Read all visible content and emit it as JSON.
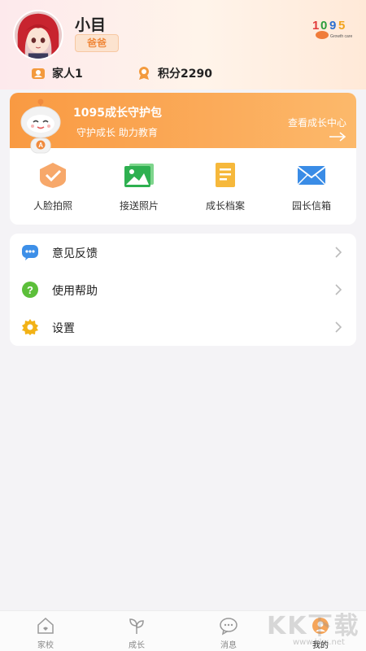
{
  "profile": {
    "name": "小目",
    "role": "爸爸",
    "logo_text": "1095",
    "logo_sub": "Growth care system"
  },
  "stats": {
    "family_label": "家人1",
    "points_label": "积分2290"
  },
  "guard_pack": {
    "title": "1095成长守护包",
    "subtitle": "守护成长 助力教育",
    "link": "查看成长中心"
  },
  "shortcuts": [
    {
      "label": "人脸拍照",
      "icon": "face-check-icon"
    },
    {
      "label": "接送照片",
      "icon": "photos-icon"
    },
    {
      "label": "成长档案",
      "icon": "archive-icon"
    },
    {
      "label": "园长信箱",
      "icon": "mail-icon"
    }
  ],
  "menu": [
    {
      "label": "意见反馈",
      "icon": "feedback-icon"
    },
    {
      "label": "使用帮助",
      "icon": "help-icon"
    },
    {
      "label": "设置",
      "icon": "settings-icon"
    }
  ],
  "tabs": [
    {
      "label": "家校",
      "icon": "home-icon"
    },
    {
      "label": "成长",
      "icon": "sprout-icon"
    },
    {
      "label": "消息",
      "icon": "chat-icon"
    },
    {
      "label": "我的",
      "icon": "profile-icon",
      "active": true
    }
  ],
  "watermark": {
    "text": "KK下载",
    "sub": "www.kkx.net"
  },
  "colors": {
    "accent": "#f99a42",
    "bg": "#f4f3f6"
  }
}
